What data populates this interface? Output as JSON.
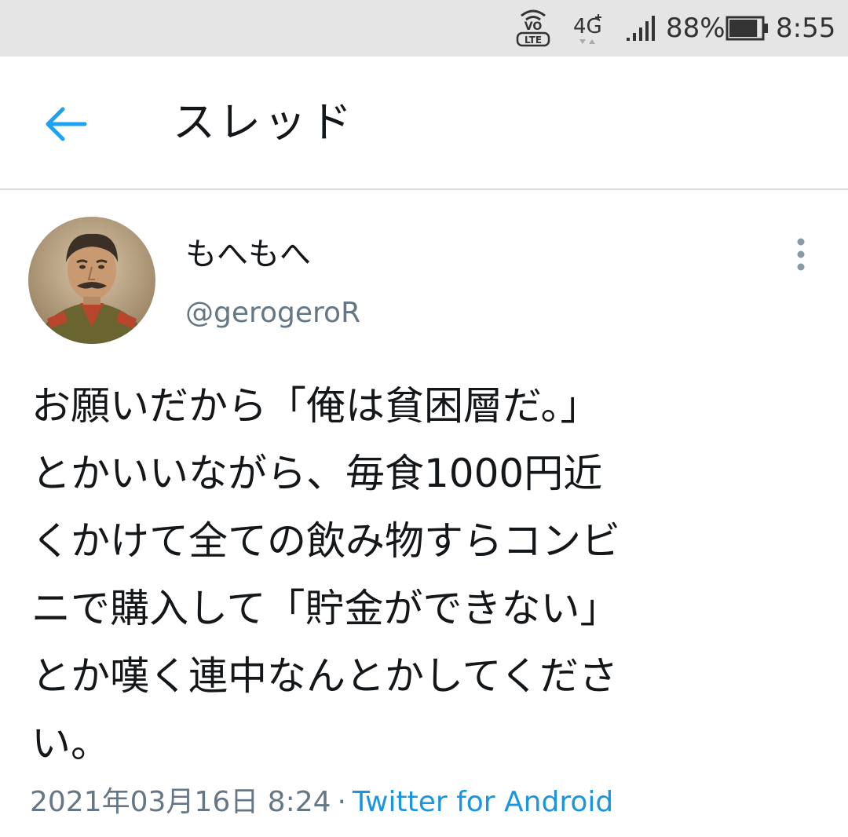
{
  "status_bar": {
    "volte_label": "VO",
    "lte_label": "LTE",
    "network_label": "4G",
    "battery_percent": "88%",
    "battery_level": 0.88,
    "time": "8:55"
  },
  "header": {
    "title": "スレッド",
    "back_icon": "arrow-left-icon",
    "accent_color": "#1da1f2"
  },
  "tweet": {
    "display_name": "もへもへ",
    "handle": "@gerogeroR",
    "text": "お願いだから「俺は貧困層だ。」\nとかいいながら、毎食1000円近\nくかけて全ての飲み物すらコンビ\nニで購入して「貯金ができない」\nとか嘆く連中なんとかしてくださ\nい。",
    "timestamp": "2021年03月16日 8:24",
    "separator": "·",
    "source": "Twitter for Android",
    "more_icon": "more-vertical-icon"
  }
}
